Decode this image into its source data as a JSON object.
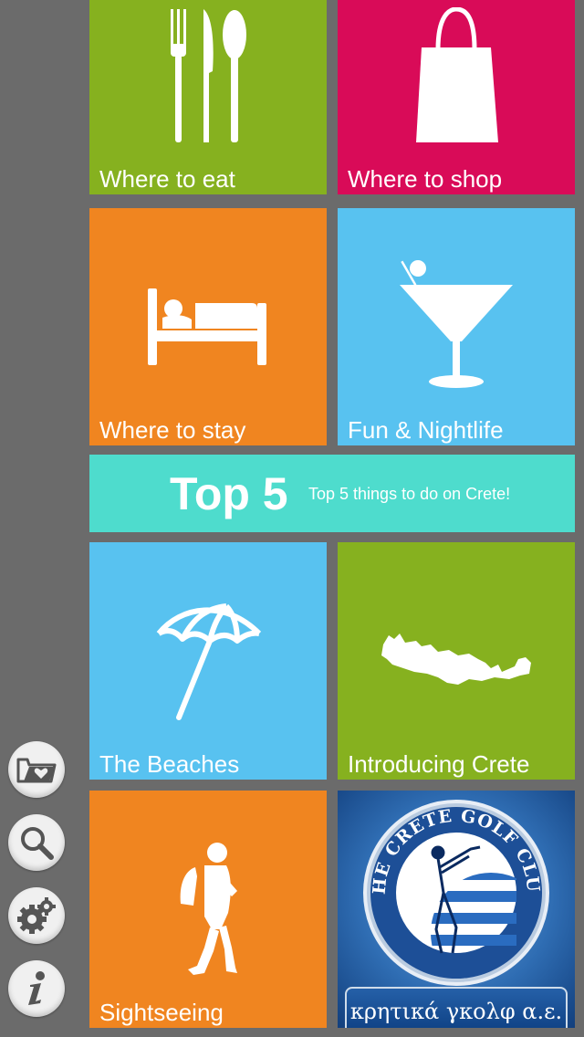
{
  "tiles": {
    "eat": {
      "label": "Where to eat",
      "color": "#86b11f"
    },
    "shop": {
      "label": "Where to shop",
      "color": "#d90b58"
    },
    "stay": {
      "label": "Where to stay",
      "color": "#f08520"
    },
    "fun": {
      "label": "Fun & Nightlife",
      "color": "#58c2f0"
    },
    "beach": {
      "label": "The Beaches",
      "color": "#58c2f0"
    },
    "crete": {
      "label": "Introducing Crete",
      "color": "#86b11f"
    },
    "sight": {
      "label": "Sightseeing",
      "color": "#f08520"
    }
  },
  "top5": {
    "title": "Top 5",
    "subtitle": "Top 5 things to do on Crete!",
    "color": "#4edccd"
  },
  "golf": {
    "arc_text": "THE CRETE GOLF CLUB",
    "greek_text": "κρητικά γκολφ α.ε."
  },
  "sidebar": {
    "icons": [
      "favorites-folder-icon",
      "search-icon",
      "settings-gear-icon",
      "info-icon"
    ]
  }
}
